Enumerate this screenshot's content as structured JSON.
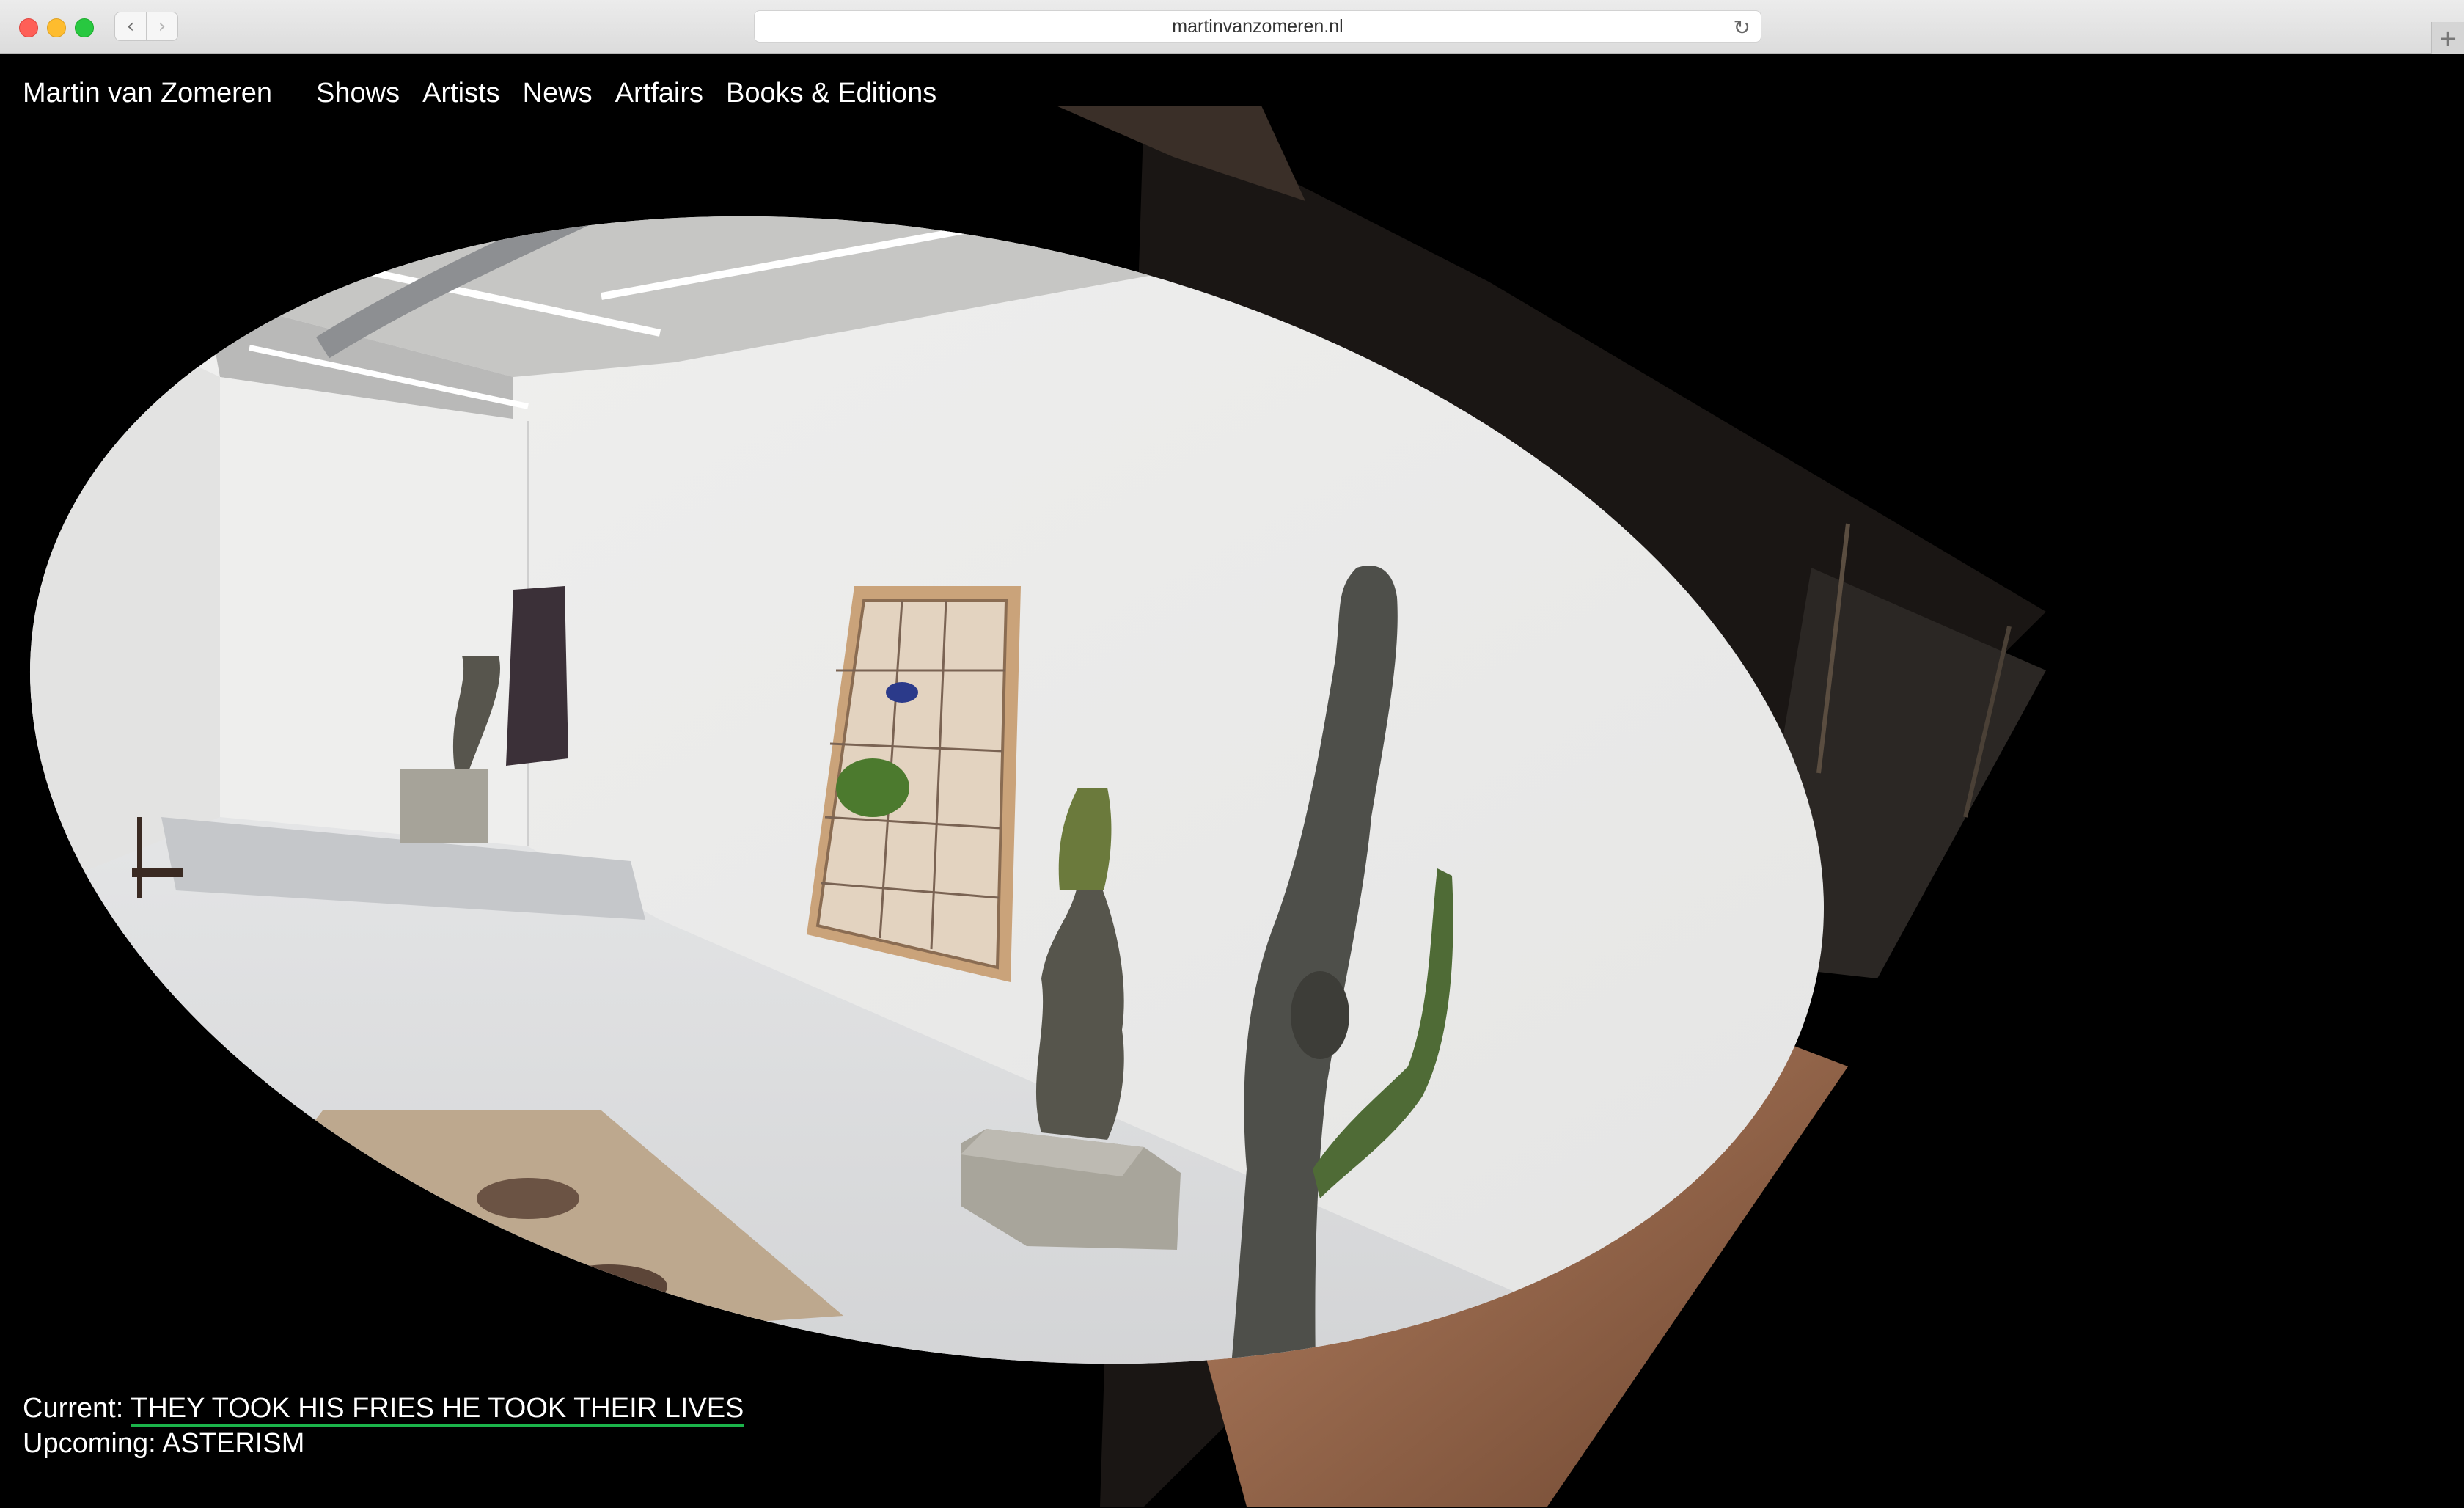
{
  "browser": {
    "url": "martinvanzomeren.nl",
    "back_icon": "‹",
    "forward_icon": "›",
    "reload_icon": "↻",
    "new_tab_icon": "+"
  },
  "site": {
    "brand": "Martin van Zomeren",
    "nav": [
      {
        "label": "Shows"
      },
      {
        "label": "Artists"
      },
      {
        "label": "News"
      },
      {
        "label": "Artfairs"
      },
      {
        "label": "Books & Editions"
      }
    ]
  },
  "shows": {
    "current_prefix": "Current: ",
    "current_title": "THEY TOOK HIS FRIES HE TOOK THEIR LIVES",
    "upcoming_prefix": "Upcoming: ",
    "upcoming_title": "ASTERISM"
  },
  "colors": {
    "background": "#000000",
    "link_underline": "#1bb34a",
    "wall": "#ebebea",
    "floor": "#d9dadb"
  }
}
